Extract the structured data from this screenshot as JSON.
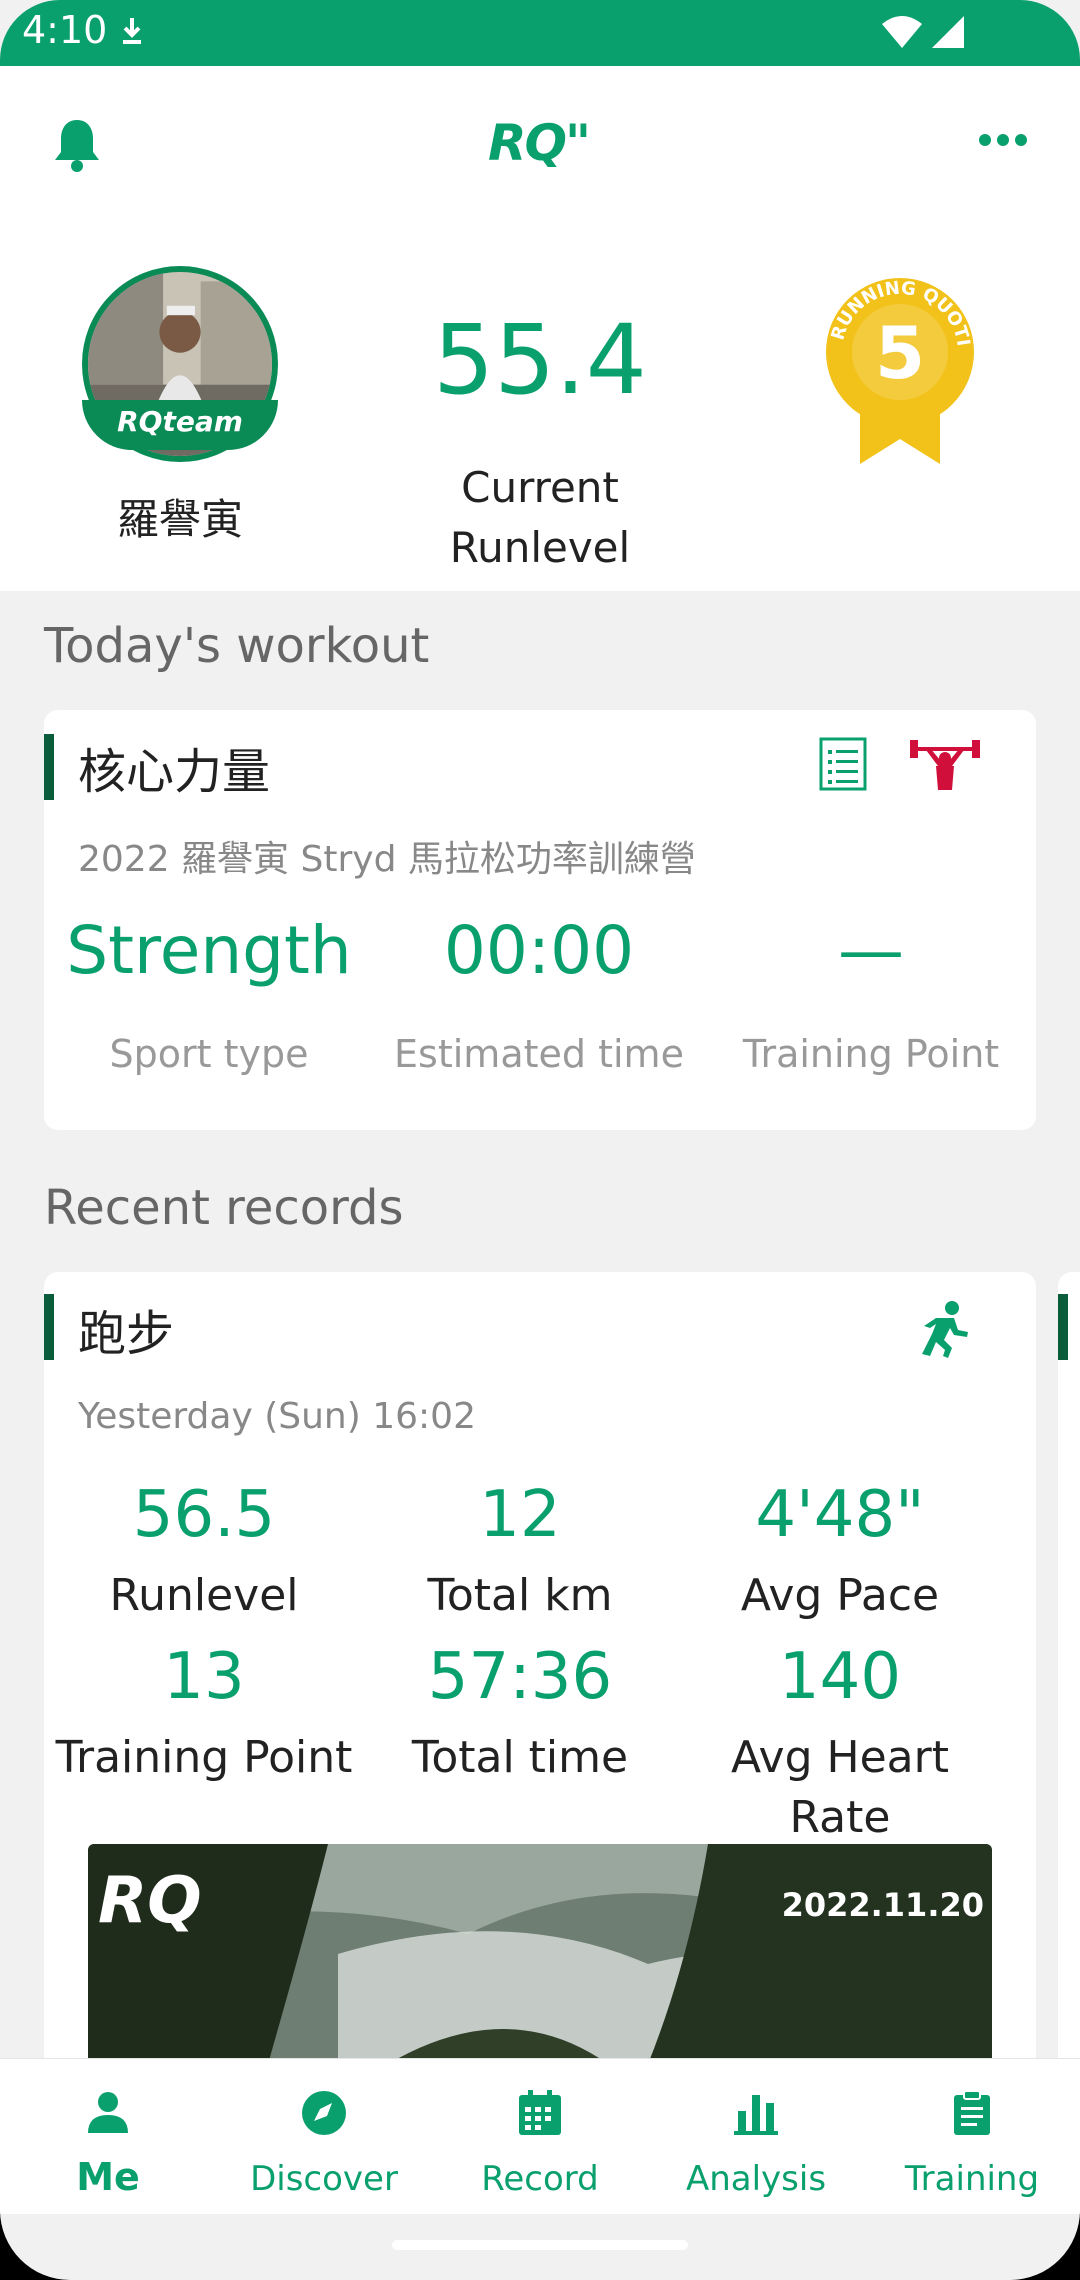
{
  "status_bar": {
    "time": "4:10"
  },
  "header": {
    "logo": "RQ\"",
    "user": {
      "name": "羅譽寅",
      "badge": "RQteam"
    },
    "runlevel": {
      "value": "55.4",
      "label": "Current Runlevel"
    },
    "medal": {
      "text_ring": "RUNNING QUOTIENT",
      "number": "5"
    }
  },
  "todays_workout": {
    "section_title": "Today's workout",
    "card": {
      "title": "核心力量",
      "subtitle": "2022 羅譽寅 Stryd 馬拉松功率訓練營",
      "stats": [
        {
          "value": "Strength",
          "label": "Sport type"
        },
        {
          "value": "00:00",
          "label": "Estimated time"
        },
        {
          "value": "—",
          "label": "Training Point"
        }
      ]
    }
  },
  "recent_records": {
    "section_title": "Recent records",
    "card": {
      "title": "跑步",
      "subtitle": "Yesterday (Sun) 16:02",
      "stats": [
        {
          "value": "56.5",
          "label": "Runlevel"
        },
        {
          "value": "12",
          "label": "Total km"
        },
        {
          "value": "4'48\"",
          "label": "Avg Pace"
        },
        {
          "value": "13",
          "label": "Training Point"
        },
        {
          "value": "57:36",
          "label": "Total time"
        },
        {
          "value": "140",
          "label": "Avg Heart Rate"
        }
      ],
      "photo": {
        "logo": "RQ",
        "date": "2022.11.20"
      }
    }
  },
  "bottom_nav": {
    "items": [
      {
        "label": "Me",
        "icon": "person-icon",
        "active": true
      },
      {
        "label": "Discover",
        "icon": "compass-icon",
        "active": false
      },
      {
        "label": "Record",
        "icon": "calendar-icon",
        "active": false
      },
      {
        "label": "Analysis",
        "icon": "bar-chart-icon",
        "active": false
      },
      {
        "label": "Training",
        "icon": "clipboard-icon",
        "active": false
      }
    ]
  },
  "colors": {
    "primary": "#0aa06e",
    "accent_dark": "#0b5c3a",
    "strength_icon": "#d0103a",
    "medal_gold": "#f2c21a"
  }
}
